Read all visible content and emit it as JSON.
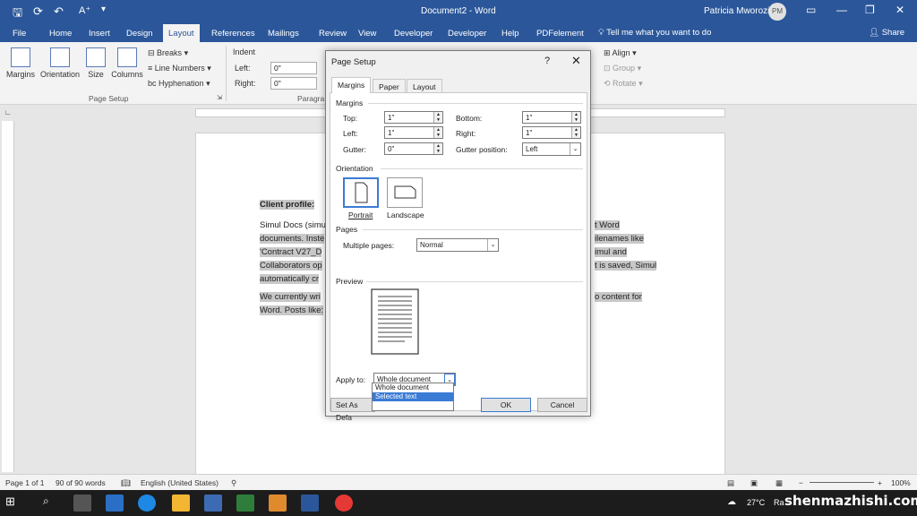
{
  "titlebar": {
    "doc_title": "Document2  -  Word",
    "user": "Patricia Mworozi",
    "initials": "PM"
  },
  "tabs": [
    "File",
    "Home",
    "Insert",
    "Design",
    "Layout",
    "References",
    "Mailings",
    "Review",
    "View",
    "Developer",
    "Developer",
    "Help",
    "PDFelement"
  ],
  "tell_me": "Tell me what you want to do",
  "share": "Share",
  "ribbon": {
    "margins": "Margins",
    "orientation": "Orientation",
    "size": "Size",
    "columns": "Columns",
    "breaks": "Breaks",
    "line_numbers": "Line Numbers",
    "hyphenation": "Hyphenation",
    "page_setup_group": "Page Setup",
    "indent": "Indent",
    "left": "Left:",
    "right": "Right:",
    "left_val": "0\"",
    "right_val": "0\"",
    "paragraph_group": "Paragra",
    "align": "Align",
    "group": "Group",
    "rotate": "Rotate"
  },
  "document": {
    "line1": "Client profile:",
    "line2a": "Simul Docs (simu",
    "line2b": "t Word",
    "line3a": "documents. Inste",
    "line3b": "ilenames like",
    "line4a": "'Contract V27_D",
    "line4b": "imul and",
    "line5a": "Collaborators op",
    "line5b": "t is saved, Simul",
    "line6a": "automatically cr",
    "line7a": "We currently wri",
    "line7b": "o content for",
    "line8a": "Word. Posts like:"
  },
  "dialog": {
    "title": "Page Setup",
    "help": "?",
    "close": "✕",
    "tabs": {
      "margins": "Margins",
      "paper": "Paper",
      "layout": "Layout"
    },
    "margins_section": "Margins",
    "top_label": "Top:",
    "top_val": "1\"",
    "bottom_label": "Bottom:",
    "bottom_val": "1\"",
    "left_label": "Left:",
    "left_val": "1\"",
    "right_label": "Right:",
    "right_val": "1\"",
    "gutter_label": "Gutter:",
    "gutter_val": "0\"",
    "gutter_pos_label": "Gutter position:",
    "gutter_pos_val": "Left",
    "orientation_section": "Orientation",
    "portrait": "Portrait",
    "landscape": "Landscape",
    "pages_section": "Pages",
    "multiple_pages_label": "Multiple pages:",
    "multiple_pages_val": "Normal",
    "preview_section": "Preview",
    "apply_to_label": "Apply to:",
    "apply_to_val": "Whole document",
    "apply_options": [
      "Whole document",
      "Selected text"
    ],
    "set_default": "Set As Defa",
    "ok": "OK",
    "cancel": "Cancel"
  },
  "status": {
    "page": "Page 1 of 1",
    "words": "90 of 90 words",
    "language": "English (United States)",
    "zoom": "100%"
  },
  "taskbar": {
    "weather": "27°C",
    "weather_tail": "Ra"
  },
  "watermark": "shenmazhishi.com"
}
